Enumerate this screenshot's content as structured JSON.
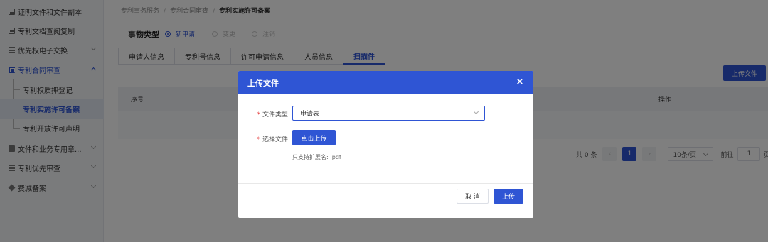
{
  "sidebar": {
    "items": [
      {
        "label": "证明文件和文件副本",
        "icon": "document-icon"
      },
      {
        "label": "专利文档查阅复制",
        "icon": "document-icon"
      },
      {
        "label": "优先权电子交换",
        "icon": "stack-icon"
      },
      {
        "label": "专利合同审查",
        "icon": "contract-icon"
      },
      {
        "label": "文件和业务专用章...",
        "icon": "clip-icon"
      },
      {
        "label": "专利优先审查",
        "icon": "stack-icon"
      },
      {
        "label": "费减备案",
        "icon": "diamond-icon"
      }
    ],
    "sub_items": [
      {
        "label": "专利权质押登记"
      },
      {
        "label": "专利实施许可备案"
      },
      {
        "label": "专利开放许可声明"
      }
    ]
  },
  "breadcrumb": {
    "level1": "专利事务服务",
    "level2": "专利合同审查",
    "current": "专利实施许可备案",
    "separator": "/"
  },
  "business_type": {
    "label": "事物类型",
    "options": [
      "新申请",
      "变更",
      "注销"
    ],
    "selected": "新申请"
  },
  "tabs": [
    "申请人信息",
    "专利号信息",
    "许可申请信息",
    "人员信息",
    "扫描件"
  ],
  "active_tab": "扫描件",
  "upload_button": "上传文件",
  "table": {
    "columns": [
      "序号",
      "操作"
    ]
  },
  "pagination": {
    "total": "共 0 条",
    "current_page": "1",
    "page_size": "10条/页",
    "goto_label": "前往",
    "goto_value": "1",
    "page_suffix": "页",
    "prev": "‹",
    "next": "›"
  },
  "dialog": {
    "title": "上传文件",
    "close": "×",
    "required_mark": "*",
    "file_type_label": "文件类型",
    "file_type_value": "申请表",
    "select_file_label": "选择文件",
    "click_upload": "点击上传",
    "hint": "只支持扩展名: .pdf",
    "cancel": "取 消",
    "confirm": "上传"
  },
  "colors": {
    "primary": "#2f55d4",
    "required": "#e64545",
    "overlay": "rgba(0,0,0,0.5)"
  }
}
